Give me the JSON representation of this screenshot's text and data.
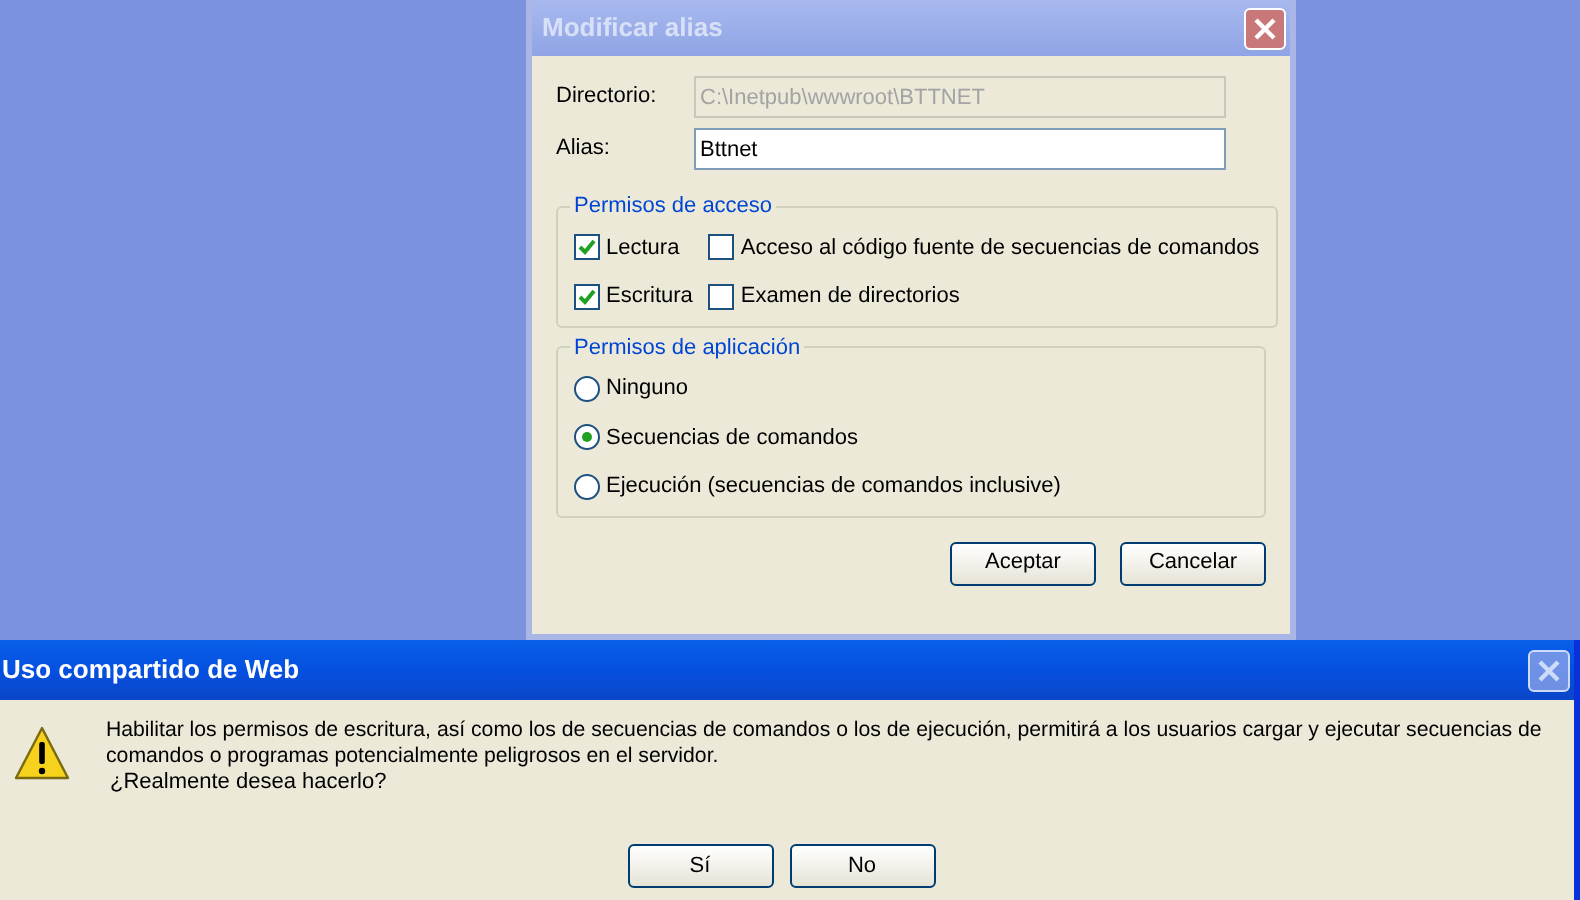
{
  "alias_dialog": {
    "title": "Modificar alias",
    "close_enabled": true,
    "fields": [
      {
        "label": "Directorio:",
        "value": "C:\\Inetpub\\wwwroot\\BTTNET",
        "disabled": true
      },
      {
        "label": "Alias:",
        "value": "Bttnet",
        "disabled": false
      }
    ],
    "access_group": {
      "title": "Permisos de acceso",
      "options": [
        {
          "label": "Lectura",
          "checked": true
        },
        {
          "label": "Acceso al código fuente de secuencias de comandos",
          "checked": false
        },
        {
          "label": "Escritura",
          "checked": true
        },
        {
          "label": "Examen de directorios",
          "checked": false
        }
      ]
    },
    "app_group": {
      "title": "Permisos de aplicación",
      "options": [
        {
          "label": "Ninguno",
          "selected": false
        },
        {
          "label": "Secuencias de comandos",
          "selected": true
        },
        {
          "label": "Ejecución (secuencias de comandos inclusive)",
          "selected": false
        }
      ]
    },
    "buttons": [
      "Aceptar",
      "Cancelar"
    ]
  },
  "alert_dialog": {
    "title": "Uso compartido de Web",
    "close_enabled": false,
    "message": "Habilitar los permisos de escritura, así como los de secuencias de comandos o los de ejecución, permitirá a los usuarios cargar y ejecutar secuencias de comandos o programas potencialmente peligrosos en el servidor.",
    "question": "¿Realmente desea hacerlo?",
    "buttons": [
      "Sí",
      "No"
    ]
  }
}
